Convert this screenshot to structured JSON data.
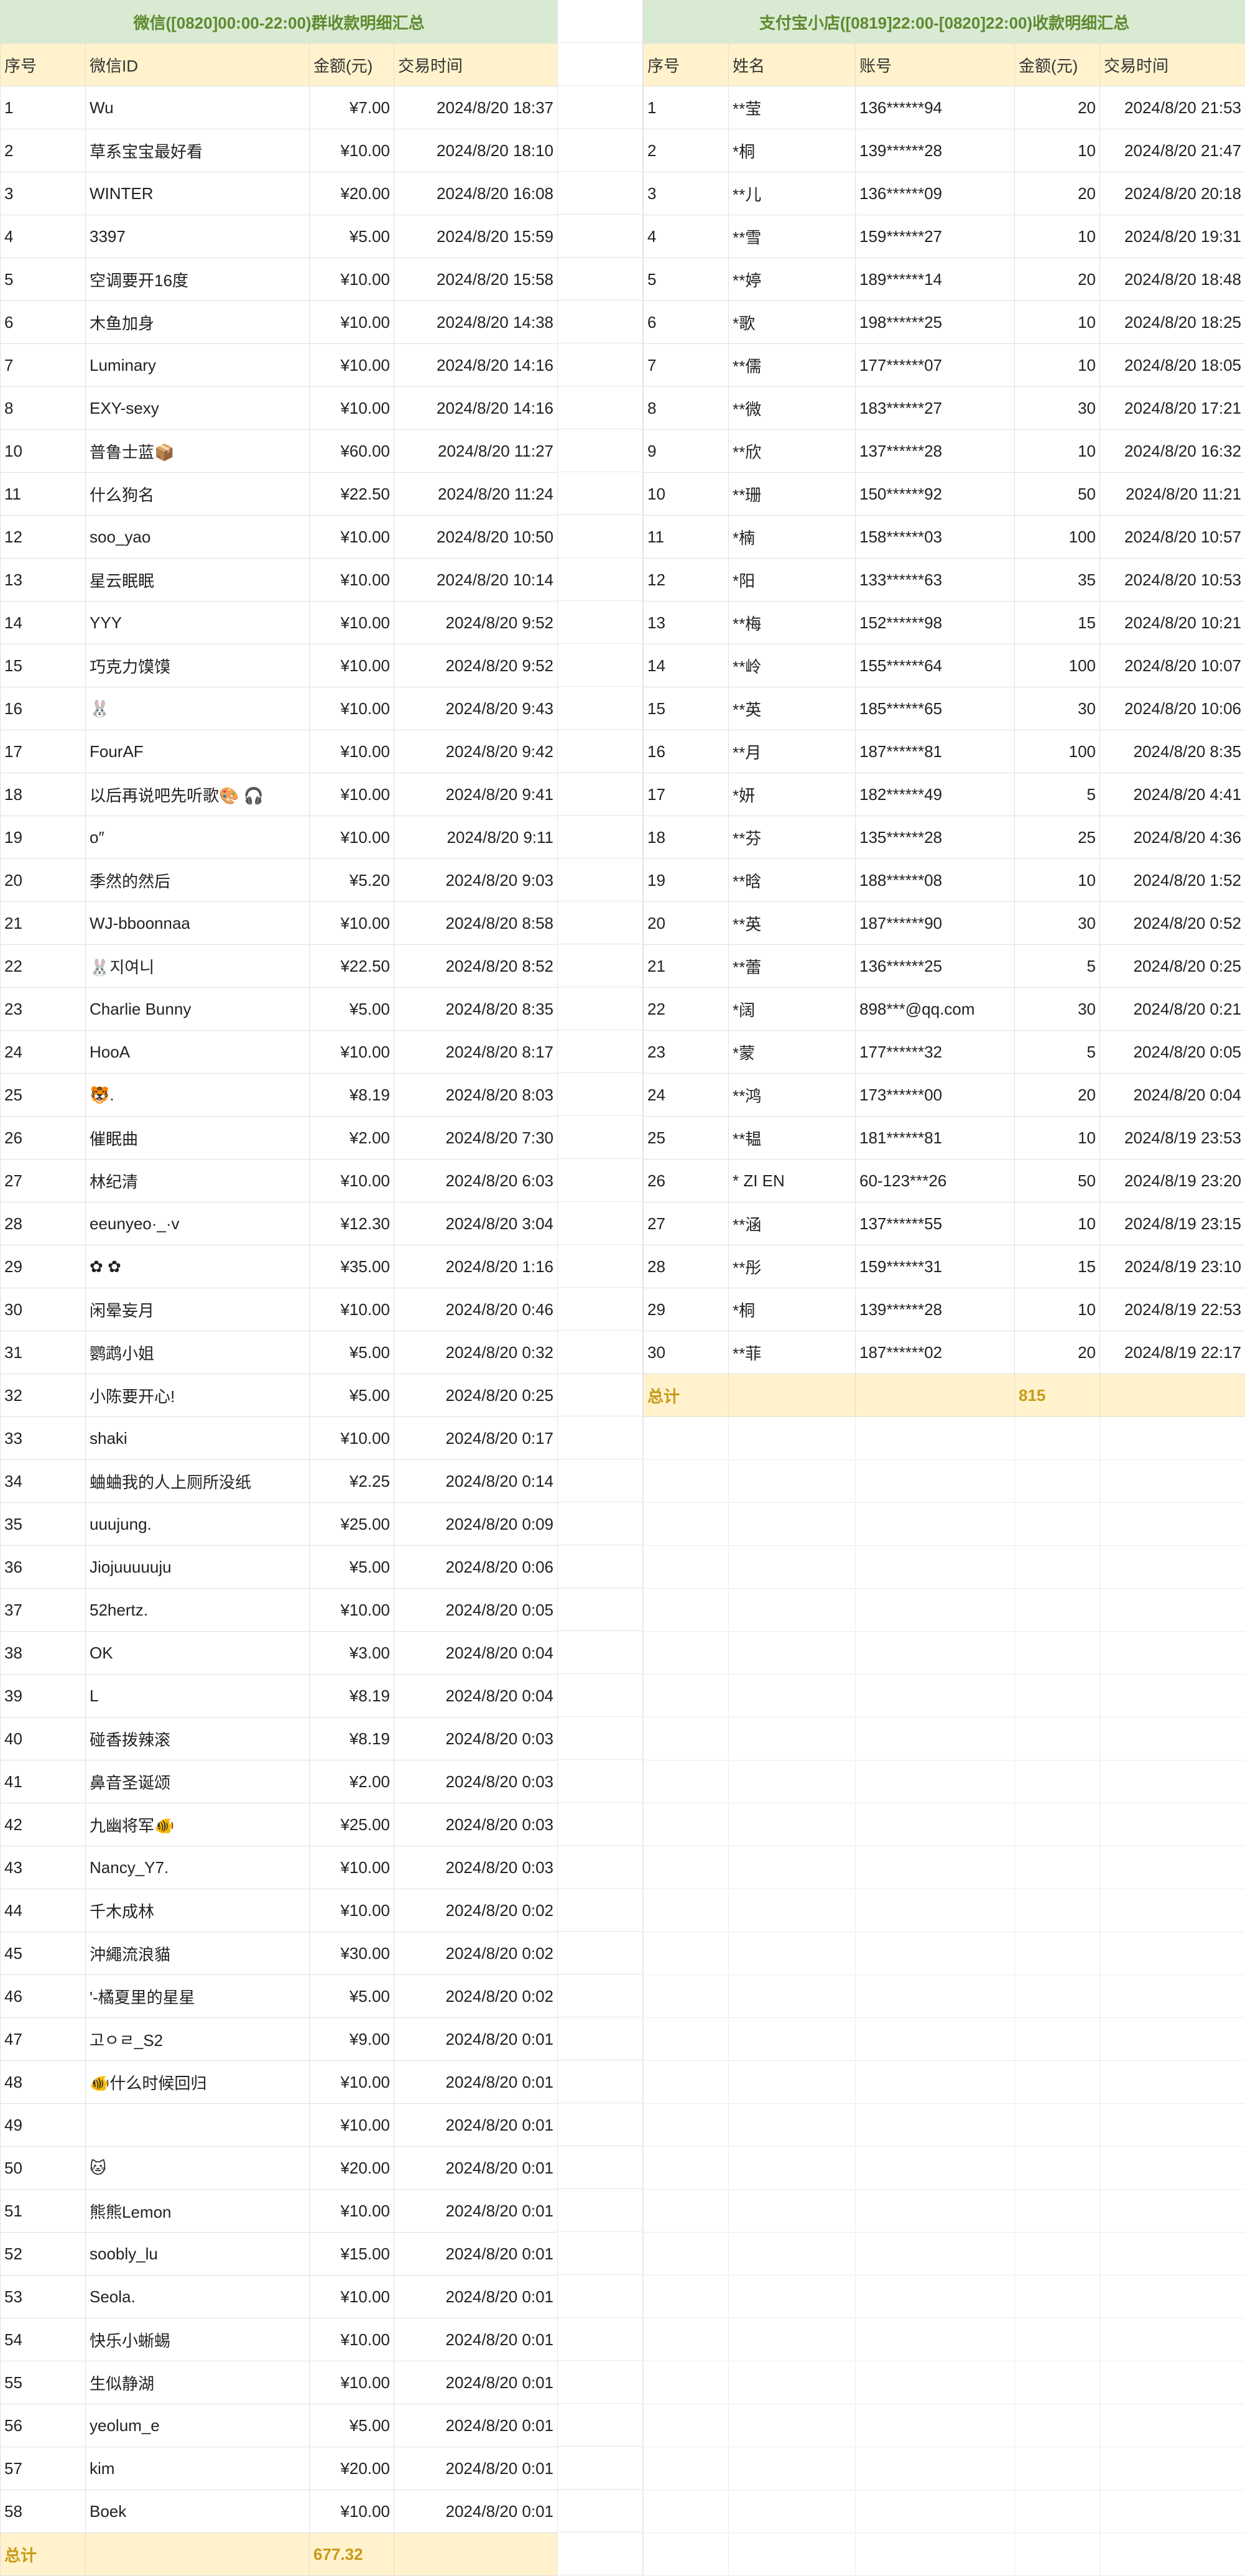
{
  "wechat": {
    "title": "微信([0820]00:00-22:00)群收款明细汇总",
    "headers": [
      "序号",
      "微信ID",
      "金额(元)",
      "交易时间"
    ],
    "rows": [
      [
        "1",
        "Wu",
        "¥7.00",
        "2024/8/20 18:37"
      ],
      [
        "2",
        "草系宝宝最好看",
        "¥10.00",
        "2024/8/20 18:10"
      ],
      [
        "3",
        "WINTER",
        "¥20.00",
        "2024/8/20 16:08"
      ],
      [
        "4",
        "3397",
        "¥5.00",
        "2024/8/20 15:59"
      ],
      [
        "5",
        "空调要开16度",
        "¥10.00",
        "2024/8/20 15:58"
      ],
      [
        "6",
        "木鱼加身",
        "¥10.00",
        "2024/8/20 14:38"
      ],
      [
        "7",
        "Luminary",
        "¥10.00",
        "2024/8/20 14:16"
      ],
      [
        "8",
        "EXY-sexy",
        "¥10.00",
        "2024/8/20 14:16"
      ],
      [
        "10",
        "普鲁士蓝📦",
        "¥60.00",
        "2024/8/20 11:27"
      ],
      [
        "11",
        "什么狗名",
        "¥22.50",
        "2024/8/20 11:24"
      ],
      [
        "12",
        "soo_yao",
        "¥10.00",
        "2024/8/20 10:50"
      ],
      [
        "13",
        "星云眠眠",
        "¥10.00",
        "2024/8/20 10:14"
      ],
      [
        "14",
        "YYY",
        "¥10.00",
        "2024/8/20 9:52"
      ],
      [
        "15",
        "巧克力馍馍",
        "¥10.00",
        "2024/8/20 9:52"
      ],
      [
        "16",
        "🐰",
        "¥10.00",
        "2024/8/20 9:43"
      ],
      [
        "17",
        "FourAF",
        "¥10.00",
        "2024/8/20 9:42"
      ],
      [
        "18",
        "以后再说吧先听歌🎨 🎧",
        "¥10.00",
        "2024/8/20 9:41"
      ],
      [
        "19",
        "o″",
        "¥10.00",
        "2024/8/20 9:11"
      ],
      [
        "20",
        "季然的然后",
        "¥5.20",
        "2024/8/20 9:03"
      ],
      [
        "21",
        "WJ-bboonnaa",
        "¥10.00",
        "2024/8/20 8:58"
      ],
      [
        "22",
        "🐰지여니",
        "¥22.50",
        "2024/8/20 8:52"
      ],
      [
        "23",
        "Charlie Bunny",
        "¥5.00",
        "2024/8/20 8:35"
      ],
      [
        "24",
        "HooA",
        "¥10.00",
        "2024/8/20 8:17"
      ],
      [
        "25",
        "🐯.",
        "¥8.19",
        "2024/8/20 8:03"
      ],
      [
        "26",
        "催眠曲",
        "¥2.00",
        "2024/8/20 7:30"
      ],
      [
        "27",
        "林纪清",
        "¥10.00",
        "2024/8/20 6:03"
      ],
      [
        "28",
        "eeunyeo·_·v",
        "¥12.30",
        "2024/8/20 3:04"
      ],
      [
        "29",
        "✿ ✿",
        "¥35.00",
        "2024/8/20 1:16"
      ],
      [
        "30",
        "闲晕妄月",
        "¥10.00",
        "2024/8/20 0:46"
      ],
      [
        "31",
        "鹦鹉小姐",
        "¥5.00",
        "2024/8/20 0:32"
      ],
      [
        "32",
        "小陈要开心!",
        "¥5.00",
        "2024/8/20 0:25"
      ],
      [
        "33",
        "shaki",
        "¥10.00",
        "2024/8/20 0:17"
      ],
      [
        "34",
        "蛐蛐我的人上厕所没纸",
        "¥2.25",
        "2024/8/20 0:14"
      ],
      [
        "35",
        "uuujung.",
        "¥25.00",
        "2024/8/20 0:09"
      ],
      [
        "36",
        "Jiojuuuuuju",
        "¥5.00",
        "2024/8/20 0:06"
      ],
      [
        "37",
        "52hertz.",
        "¥10.00",
        "2024/8/20 0:05"
      ],
      [
        "38",
        "OK",
        "¥3.00",
        "2024/8/20 0:04"
      ],
      [
        "39",
        "L",
        "¥8.19",
        "2024/8/20 0:04"
      ],
      [
        "40",
        "碰香拨辣滚",
        "¥8.19",
        "2024/8/20 0:03"
      ],
      [
        "41",
        "鼻音圣诞颂",
        "¥2.00",
        "2024/8/20 0:03"
      ],
      [
        "42",
        "九幽将军🐠",
        "¥25.00",
        "2024/8/20 0:03"
      ],
      [
        "43",
        "Nancy_Y7.",
        "¥10.00",
        "2024/8/20 0:03"
      ],
      [
        "44",
        "千木成林",
        "¥10.00",
        "2024/8/20 0:02"
      ],
      [
        "45",
        "沖繩流浪貓",
        "¥30.00",
        "2024/8/20 0:02"
      ],
      [
        "46",
        "'-橘夏里的星星",
        "¥5.00",
        "2024/8/20 0:02"
      ],
      [
        "47",
        "고ㅇㄹ_S2",
        "¥9.00",
        "2024/8/20 0:01"
      ],
      [
        "48",
        "🐠什么时候回归",
        "¥10.00",
        "2024/8/20 0:01"
      ],
      [
        "49",
        "",
        "¥10.00",
        "2024/8/20 0:01"
      ],
      [
        "50",
        "🐱",
        "¥20.00",
        "2024/8/20 0:01"
      ],
      [
        "51",
        "熊熊Lemon",
        "¥10.00",
        "2024/8/20 0:01"
      ],
      [
        "52",
        "soobly_lu",
        "¥15.00",
        "2024/8/20 0:01"
      ],
      [
        "53",
        "Seola.",
        "¥10.00",
        "2024/8/20 0:01"
      ],
      [
        "54",
        "快乐小蜥蜴",
        "¥10.00",
        "2024/8/20 0:01"
      ],
      [
        "55",
        "生似静湖",
        "¥10.00",
        "2024/8/20 0:01"
      ],
      [
        "56",
        "yeolum_e",
        "¥5.00",
        "2024/8/20 0:01"
      ],
      [
        "57",
        "kim",
        "¥20.00",
        "2024/8/20 0:01"
      ],
      [
        "58",
        "Boek",
        "¥10.00",
        "2024/8/20 0:01"
      ]
    ],
    "total_label": "总计",
    "total_value": "677.32"
  },
  "alipay": {
    "title": "支付宝小店([0819]22:00-[0820]22:00)收款明细汇总",
    "headers": [
      "序号",
      "姓名",
      "账号",
      "金额(元)",
      "交易时间"
    ],
    "rows": [
      [
        "1",
        "**莹",
        "136******94",
        "20",
        "2024/8/20 21:53"
      ],
      [
        "2",
        "*桐",
        "139******28",
        "10",
        "2024/8/20 21:47"
      ],
      [
        "3",
        "**儿",
        "136******09",
        "20",
        "2024/8/20 20:18"
      ],
      [
        "4",
        "**雪",
        "159******27",
        "10",
        "2024/8/20 19:31"
      ],
      [
        "5",
        "**婷",
        "189******14",
        "20",
        "2024/8/20 18:48"
      ],
      [
        "6",
        "*歌",
        "198******25",
        "10",
        "2024/8/20 18:25"
      ],
      [
        "7",
        "**儒",
        "177******07",
        "10",
        "2024/8/20 18:05"
      ],
      [
        "8",
        "**微",
        "183******27",
        "30",
        "2024/8/20 17:21"
      ],
      [
        "9",
        "**欣",
        "137******28",
        "10",
        "2024/8/20 16:32"
      ],
      [
        "10",
        "**珊",
        "150******92",
        "50",
        "2024/8/20 11:21"
      ],
      [
        "11",
        "*楠",
        "158******03",
        "100",
        "2024/8/20 10:57"
      ],
      [
        "12",
        "*阳",
        "133******63",
        "35",
        "2024/8/20 10:53"
      ],
      [
        "13",
        "**梅",
        "152******98",
        "15",
        "2024/8/20 10:21"
      ],
      [
        "14",
        "**岭",
        "155******64",
        "100",
        "2024/8/20 10:07"
      ],
      [
        "15",
        "**英",
        "185******65",
        "30",
        "2024/8/20 10:06"
      ],
      [
        "16",
        "**月",
        "187******81",
        "100",
        "2024/8/20 8:35"
      ],
      [
        "17",
        "*妍",
        "182******49",
        "5",
        "2024/8/20 4:41"
      ],
      [
        "18",
        "**芬",
        "135******28",
        "25",
        "2024/8/20 4:36"
      ],
      [
        "19",
        "**晗",
        "188******08",
        "10",
        "2024/8/20 1:52"
      ],
      [
        "20",
        "**英",
        "187******90",
        "30",
        "2024/8/20 0:52"
      ],
      [
        "21",
        "**蕾",
        "136******25",
        "5",
        "2024/8/20 0:25"
      ],
      [
        "22",
        "*阔",
        "898***@qq.com",
        "30",
        "2024/8/20 0:21"
      ],
      [
        "23",
        "*蒙",
        "177******32",
        "5",
        "2024/8/20 0:05"
      ],
      [
        "24",
        "**鸿",
        "173******00",
        "20",
        "2024/8/20 0:04"
      ],
      [
        "25",
        "**韫",
        "181******81",
        "10",
        "2024/8/19 23:53"
      ],
      [
        "26",
        "* ZI EN",
        "60-123***26",
        "50",
        "2024/8/19 23:20"
      ],
      [
        "27",
        "**涵",
        "137******55",
        "10",
        "2024/8/19 23:15"
      ],
      [
        "28",
        "**彤",
        "159******31",
        "15",
        "2024/8/19 23:10"
      ],
      [
        "29",
        "*桐",
        "139******28",
        "10",
        "2024/8/19 22:53"
      ],
      [
        "30",
        "**菲",
        "187******02",
        "20",
        "2024/8/19 22:17"
      ]
    ],
    "total_label": "总计",
    "total_value": "815"
  }
}
